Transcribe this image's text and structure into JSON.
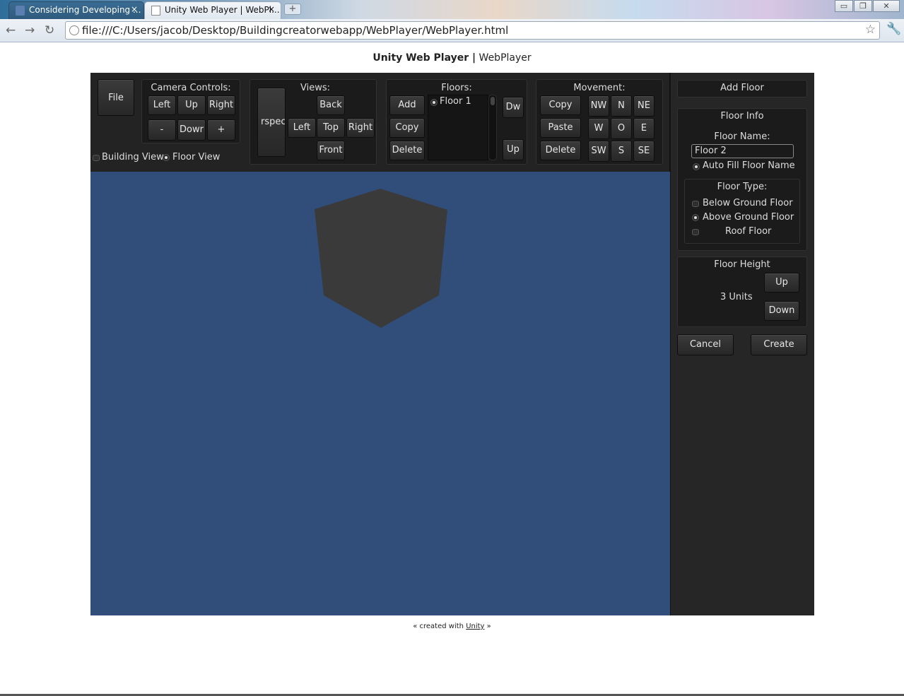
{
  "browser": {
    "tabs": [
      {
        "label": "Considering Developing ..."
      },
      {
        "label": "Unity Web Player | WebPl..."
      }
    ],
    "close_glyph": "×",
    "new_tab_glyph": "+",
    "window_buttons": [
      "▭",
      "❐",
      "✕"
    ],
    "url": "file:///C:/Users/jacob/Desktop/Buildingcreatorwebapp/WebPlayer/WebPlayer.html",
    "icons": [
      "back-icon",
      "forward-icon",
      "reload-icon",
      "globe-icon",
      "star-icon",
      "wrench-icon"
    ]
  },
  "page": {
    "title_bold": "Unity Web Player |",
    "title_rest": " WebPlayer",
    "footer_pre": "« created with ",
    "footer_link": "Unity",
    "footer_post": " »"
  },
  "app": {
    "file_label": "File",
    "camera": {
      "title": "Camera Controls:",
      "buttons": [
        "Left",
        "Up",
        "Right",
        "-",
        "Dowr",
        "+"
      ]
    },
    "view_mode": {
      "building": "Building View",
      "floor": "Floor View",
      "selected": "floor"
    },
    "views": {
      "title": "Views:",
      "perspective": "rspec",
      "buttons": [
        "Back",
        "Left",
        "Top",
        "Right",
        "Front"
      ]
    },
    "floors": {
      "title": "Floors:",
      "buttons": [
        "Add",
        "Copy",
        "Delete"
      ],
      "list": [
        "Floor 1"
      ],
      "down": "Dw",
      "up": "Up"
    },
    "movement": {
      "title": "Movement:",
      "buttons": [
        "Copy",
        "Paste",
        "Delete"
      ],
      "directions": [
        "NW",
        "N",
        "NE",
        "W",
        "O",
        "E",
        "SW",
        "S",
        "SE"
      ]
    },
    "side": {
      "add_floor": "Add Floor",
      "floor_info": "Floor Info",
      "floor_name_label": "Floor Name:",
      "floor_name_value": "Floor 2",
      "auto_fill": "Auto Fill Floor Name",
      "floor_type_title": "Floor Type:",
      "floor_types": [
        "Below Ground Floor",
        "Above Ground Floor",
        "Roof Floor"
      ],
      "floor_type_selected": "Above Ground Floor",
      "height_title": "Floor Height",
      "height_value": "3 Units",
      "height_up": "Up",
      "height_down": "Down",
      "cancel": "Cancel",
      "create": "Create"
    },
    "colors": {
      "viewport": "#314d79",
      "panel": "#232323",
      "cube": "#3a3a3a"
    }
  }
}
